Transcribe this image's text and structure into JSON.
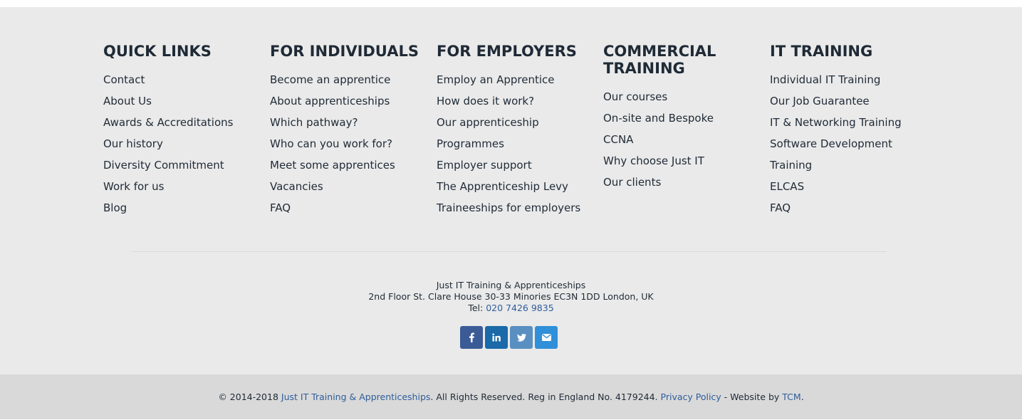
{
  "columns": [
    {
      "title": "QUICK LINKS",
      "links": [
        "Contact",
        "About Us",
        "Awards & Accreditations",
        "Our history",
        "Diversity Commitment",
        "Work for us",
        "Blog"
      ]
    },
    {
      "title": "FOR INDIVIDUALS",
      "links": [
        "Become an apprentice",
        "About apprenticeships",
        "Which pathway?",
        "Who can you work for?",
        "Meet some apprentices",
        "Vacancies",
        "FAQ"
      ]
    },
    {
      "title": "FOR EMPLOYERS",
      "links": [
        "Employ an Apprentice",
        "How does it work?",
        "Our apprenticeship",
        "Programmes",
        "Employer support",
        "The Apprenticeship Levy",
        "Traineeships for employers"
      ]
    },
    {
      "title": "COMMERCIAL TRAINING",
      "links": [
        "Our courses",
        "On-site and Bespoke",
        "CCNA",
        "Why choose Just IT",
        "Our clients"
      ]
    },
    {
      "title": "IT TRAINING",
      "links": [
        "Individual IT Training",
        "Our Job Guarantee",
        "IT & Networking Training",
        "Software Development",
        "Training",
        "ELCAS",
        "FAQ"
      ]
    }
  ],
  "contact": {
    "company": "Just IT Training & Apprenticeships",
    "address": "2nd Floor St. Clare House 30-33 Minories EC3N 1DD London, UK",
    "tel_label": "Tel: ",
    "tel": "020 7426 9835"
  },
  "social": [
    {
      "name": "facebook-icon",
      "glyph": "f",
      "color": "#3b5b97"
    },
    {
      "name": "linkedin-icon",
      "glyph": "in",
      "color": "#1a69a8"
    },
    {
      "name": "twitter-icon",
      "glyph": "🐦",
      "color": "#5a8fc2"
    },
    {
      "name": "email-icon",
      "glyph": "✉",
      "color": "#2f8fd8"
    }
  ],
  "bottom": {
    "copyright": "© 2014-2018 ",
    "company_link": "Just IT Training & Apprenticeships",
    "rights": ". All Rights Reserved. Reg in England No. 4179244. ",
    "privacy_link": "Privacy Policy",
    "website_by": " - Website by ",
    "tcm_link": "TCM",
    "end": "."
  }
}
